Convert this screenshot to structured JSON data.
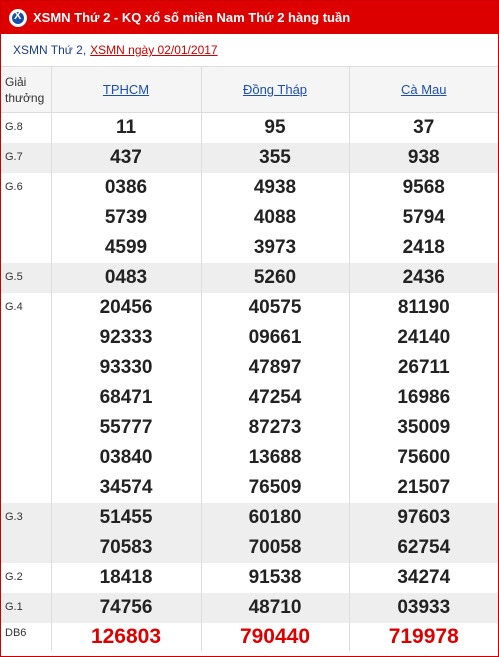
{
  "header": {
    "title": "XSMN Thứ 2 - KQ xổ số miền Nam Thứ 2 hàng tuần"
  },
  "subtitle": {
    "prefix": "XSMN Thứ 2,",
    "link": "XSMN ngày 02/01/2017"
  },
  "table": {
    "prize_header": "Giải thưởng",
    "provinces": [
      "TPHCM",
      "Đồng Tháp",
      "Cà Mau"
    ],
    "rows": [
      {
        "label": "G.8",
        "values": [
          [
            "11"
          ],
          [
            "95"
          ],
          [
            "37"
          ]
        ]
      },
      {
        "label": "G.7",
        "values": [
          [
            "437"
          ],
          [
            "355"
          ],
          [
            "938"
          ]
        ]
      },
      {
        "label": "G.6",
        "values": [
          [
            "0386",
            "5739",
            "4599"
          ],
          [
            "4938",
            "4088",
            "3973"
          ],
          [
            "9568",
            "5794",
            "2418"
          ]
        ]
      },
      {
        "label": "G.5",
        "values": [
          [
            "0483"
          ],
          [
            "5260"
          ],
          [
            "2436"
          ]
        ]
      },
      {
        "label": "G.4",
        "values": [
          [
            "20456",
            "92333",
            "93330",
            "68471",
            "55777",
            "03840",
            "34574"
          ],
          [
            "40575",
            "09661",
            "47897",
            "47254",
            "87273",
            "13688",
            "76509"
          ],
          [
            "81190",
            "24140",
            "26711",
            "16986",
            "35009",
            "75600",
            "21507"
          ]
        ]
      },
      {
        "label": "G.3",
        "values": [
          [
            "51455",
            "70583"
          ],
          [
            "60180",
            "70058"
          ],
          [
            "97603",
            "62754"
          ]
        ]
      },
      {
        "label": "G.2",
        "values": [
          [
            "18418"
          ],
          [
            "91538"
          ],
          [
            "34274"
          ]
        ]
      },
      {
        "label": "G.1",
        "values": [
          [
            "74756"
          ],
          [
            "48710"
          ],
          [
            "03933"
          ]
        ]
      },
      {
        "label": "DB6",
        "values": [
          [
            "126803"
          ],
          [
            "790440"
          ],
          [
            "719978"
          ]
        ]
      }
    ]
  }
}
